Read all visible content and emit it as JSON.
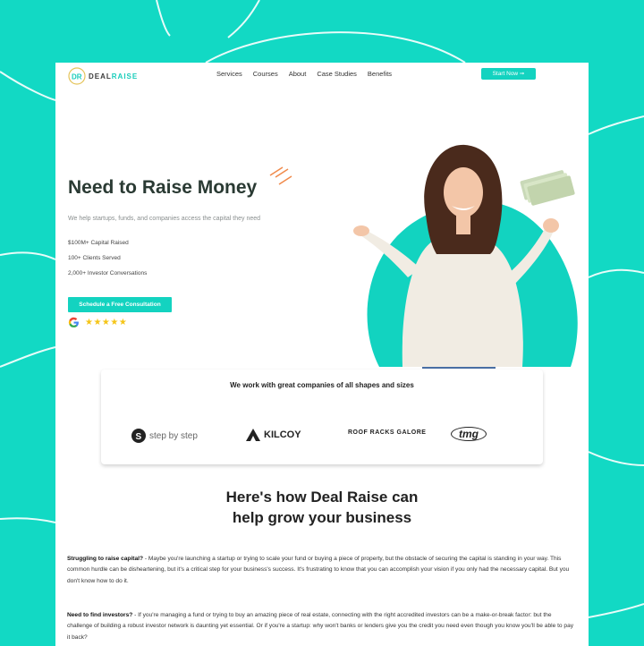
{
  "brand": {
    "name_part1": "DEAL",
    "name_part2": "RAISE",
    "accent": "#13d3c0",
    "background": "#12d9c4"
  },
  "nav": {
    "links": [
      "Services",
      "Courses",
      "About",
      "Case Studies",
      "Benefits"
    ],
    "cta_label": "Start Now ➞"
  },
  "hero": {
    "title": "Need to Raise Money",
    "subtitle": "We help startups, funds, and companies access the capital they need",
    "stats": [
      "$100M+ Capital Raised",
      "100+ Clients Served",
      "2,000+ Investor Conversations"
    ],
    "cta_label": "Schedule a Free Consultation",
    "rating": {
      "stars": "★★★★★",
      "icon": "google-icon"
    }
  },
  "companies": {
    "title": "We work with great companies of all shapes and sizes",
    "logos": [
      "step by step",
      "KILCOY",
      "ROOF RACKS GALORE",
      "tmg"
    ]
  },
  "section": {
    "title_line1": "Here's how Deal Raise can",
    "title_line2": "help grow your business",
    "paragraphs": [
      {
        "heading": "Struggling to raise capital?",
        "body": " - Maybe you're launching a startup or trying to scale your fund or buying a piece of property, but the obstacle of securing the capital is standing in your way. This common hurdle can be disheartening, but it's a critical step for your business's success. It's frustrating to know that you can accomplish your vision if you only had the necessary capital. But you don't know how to do it."
      },
      {
        "heading": "Need to find investors?",
        "body": " - If you're managing a fund or trying to buy an amazing piece of real estate, connecting with the right accredited investors can be a make-or-break factor: but the challenge of building a robust investor network is daunting yet essential. Or if you're a startup: why won't banks or lenders give you the credit you need even though you know you'll be able to pay it back?"
      }
    ]
  }
}
